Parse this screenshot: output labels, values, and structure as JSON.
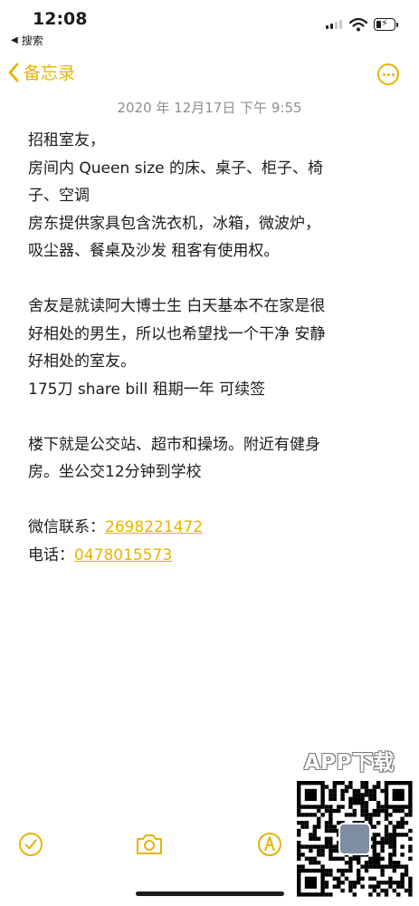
{
  "status_bar": {
    "time": "12:08",
    "back_app_label": "搜索",
    "icons": [
      "cellular-signal-icon",
      "wifi-icon",
      "battery-charging-icon"
    ]
  },
  "nav": {
    "back_label": "备忘录",
    "back_icon": "chevron-left-icon",
    "more_icon": "ellipsis-circle-icon"
  },
  "note": {
    "date": "2020 年 12月17日 下午 9:55",
    "lines": [
      "招租室友，",
      "房间内 Queen size 的床、桌子、柜子、椅",
      "子、空调",
      "房东提供家具包含洗衣机，冰箱，微波炉，",
      "吸尘器、餐桌及沙发 租客有使用权。",
      "",
      "舍友是就读阿大博士生 白天基本不在家是很",
      "好相处的男生，所以也希望找一个干净 安静",
      "好相处的室友。",
      "175刀 share bill  租期一年 可续签",
      "",
      "楼下就是公交站、超市和操场。附近有健身",
      "房。坐公交12分钟到学校",
      ""
    ],
    "wechat_label": "微信联系：",
    "wechat_value": "2698221472",
    "phone_label": "电话：",
    "phone_value": "0478015573"
  },
  "toolbar": {
    "icons": [
      "checklist-icon",
      "camera-icon",
      "markup-icon"
    ]
  },
  "watermark": {
    "text": "APP下载"
  },
  "colors": {
    "accent": "#e5b400",
    "text": "#1c1c1e",
    "secondary": "#8e8e93",
    "background": "#ffffff"
  }
}
